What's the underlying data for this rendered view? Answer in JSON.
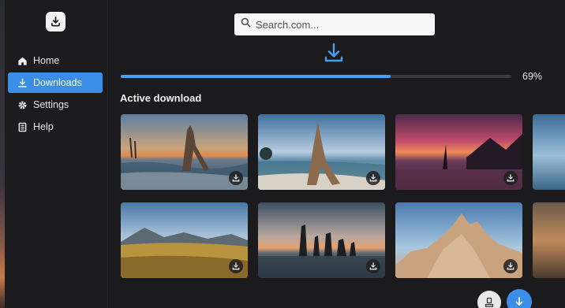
{
  "sidebar": {
    "items": [
      {
        "label": "Home",
        "icon": "home-icon"
      },
      {
        "label": "Downloads",
        "icon": "download-icon",
        "active": true
      },
      {
        "label": "Settings",
        "icon": "gear-icon"
      },
      {
        "label": "Help",
        "icon": "help-book-icon"
      }
    ]
  },
  "search": {
    "placeholder": "Search.com..."
  },
  "download": {
    "progress_percent": 69,
    "progress_label": "69%",
    "section_title": "Active download"
  },
  "gallery": {
    "tiles": [
      {
        "scene": "driftwood-beach-sunset"
      },
      {
        "scene": "driftwood-sea-cloudy"
      },
      {
        "scene": "pink-sunset-coast"
      },
      {
        "scene": "partial-blue-sea"
      },
      {
        "scene": "golden-grass-mountains"
      },
      {
        "scene": "sea-stacks-dusk"
      },
      {
        "scene": "rocky-peaks-desert"
      },
      {
        "scene": "partial-warm-landscape"
      }
    ]
  },
  "colors": {
    "accent": "#3b8ee8",
    "background": "#1b1b1d",
    "sidebar": "#1c1c1f"
  }
}
